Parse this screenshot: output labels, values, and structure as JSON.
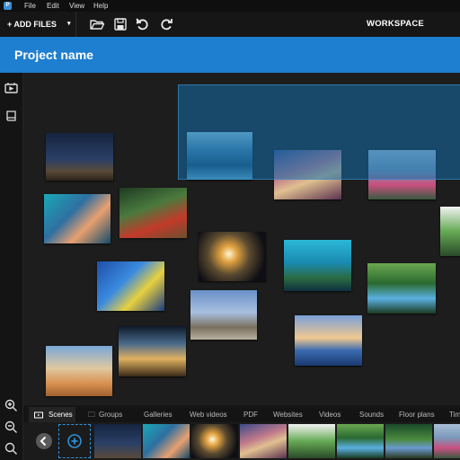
{
  "menu": {
    "items": [
      "File",
      "Edit",
      "View",
      "Help"
    ]
  },
  "toolbar": {
    "add_files_label": "+ ADD FILES",
    "workspace_label": "WORKSPACE"
  },
  "project": {
    "name": "Project name"
  },
  "bottom_tabs": [
    "Scenes",
    "Groups",
    "Galleries",
    "Web videos",
    "PDF",
    "Websites",
    "Videos",
    "Sounds",
    "Floor plans",
    "Tim"
  ],
  "icons": {
    "app_logo": "app-logo-icon",
    "open": "folder-open-icon",
    "save": "save-icon",
    "undo": "undo-icon",
    "redo": "redo-icon",
    "scenes_rail": "scenes-icon",
    "book_rail": "book-icon",
    "zoom_in": "zoom-in-icon",
    "zoom_out": "zoom-out-icon",
    "zoom_fit": "search-icon",
    "strip_prev": "chevron-left-icon",
    "strip_add": "plus-circle-icon"
  },
  "colors": {
    "accent": "#1e7ed0",
    "selection": "#146eaa",
    "background": "#1d1d1d"
  }
}
